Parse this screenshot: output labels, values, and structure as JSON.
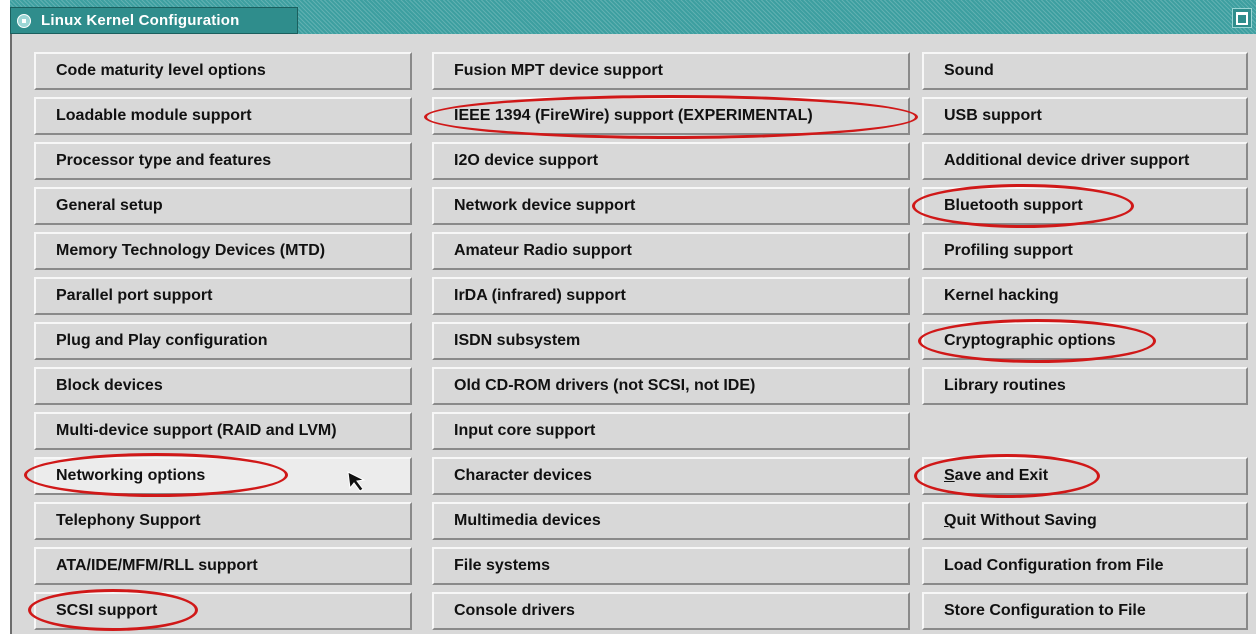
{
  "window": {
    "title": "Linux Kernel Configuration"
  },
  "columns": [
    {
      "items": [
        "Code maturity level options",
        "Loadable module support",
        "Processor type and features",
        "General setup",
        "Memory Technology Devices (MTD)",
        "Parallel port support",
        "Plug and Play configuration",
        "Block devices",
        "Multi-device support (RAID and LVM)",
        "Networking options",
        "Telephony Support",
        "ATA/IDE/MFM/RLL support",
        "SCSI support"
      ]
    },
    {
      "items": [
        "Fusion MPT device support",
        "IEEE 1394 (FireWire) support (EXPERIMENTAL)",
        "I2O device support",
        "Network device support",
        "Amateur Radio support",
        "IrDA (infrared) support",
        "ISDN subsystem",
        "Old CD-ROM drivers (not SCSI, not IDE)",
        "Input core support",
        "Character devices",
        "Multimedia devices",
        "File systems",
        "Console drivers"
      ]
    },
    {
      "items": [
        "Sound",
        "USB support",
        "Additional device driver support",
        "Bluetooth support",
        "Profiling support",
        "Kernel hacking",
        "Cryptographic options",
        "Library routines"
      ]
    }
  ],
  "actions": {
    "save_exit": {
      "mnemonic": "S",
      "rest": "ave and Exit"
    },
    "quit_no_save": {
      "mnemonic": "Q",
      "rest": "uit Without Saving"
    },
    "load_config": "Load Configuration from File",
    "store_config": "Store Configuration to File"
  },
  "highlights": {
    "color": "#d01818",
    "circled_items": [
      "Networking options",
      "SCSI support",
      "IEEE 1394 (FireWire) support (EXPERIMENTAL)",
      "Bluetooth support",
      "Cryptographic options",
      "Save and Exit"
    ]
  },
  "colors": {
    "titlebar": "#3d9fa0",
    "button_face": "#d8d8d8",
    "panel": "#d9d9d9"
  }
}
